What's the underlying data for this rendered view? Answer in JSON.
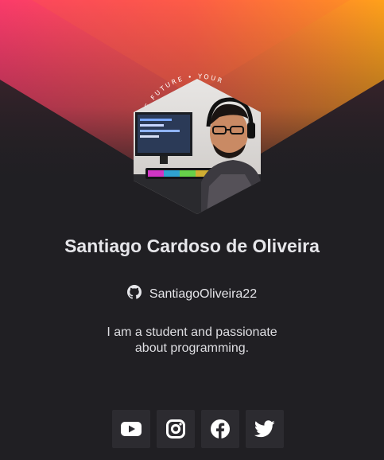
{
  "profile": {
    "name": "Santiago Cardoso de Oliveira",
    "github_handle": "SantiagoOliveira22",
    "bio": "I am a student and passionate about programming.",
    "avatar_ring_text": "LD THE FUTURE • YOUR"
  },
  "icons": {
    "github": "github-icon",
    "youtube": "youtube-icon",
    "instagram": "instagram-icon",
    "facebook": "facebook-icon",
    "twitter": "twitter-icon"
  },
  "colors": {
    "background": "#201f23",
    "gradient_start": "#fb3b6a",
    "gradient_end": "#ffa11a",
    "text": "#e6e6ea",
    "button_bg": "#2c2b30"
  }
}
